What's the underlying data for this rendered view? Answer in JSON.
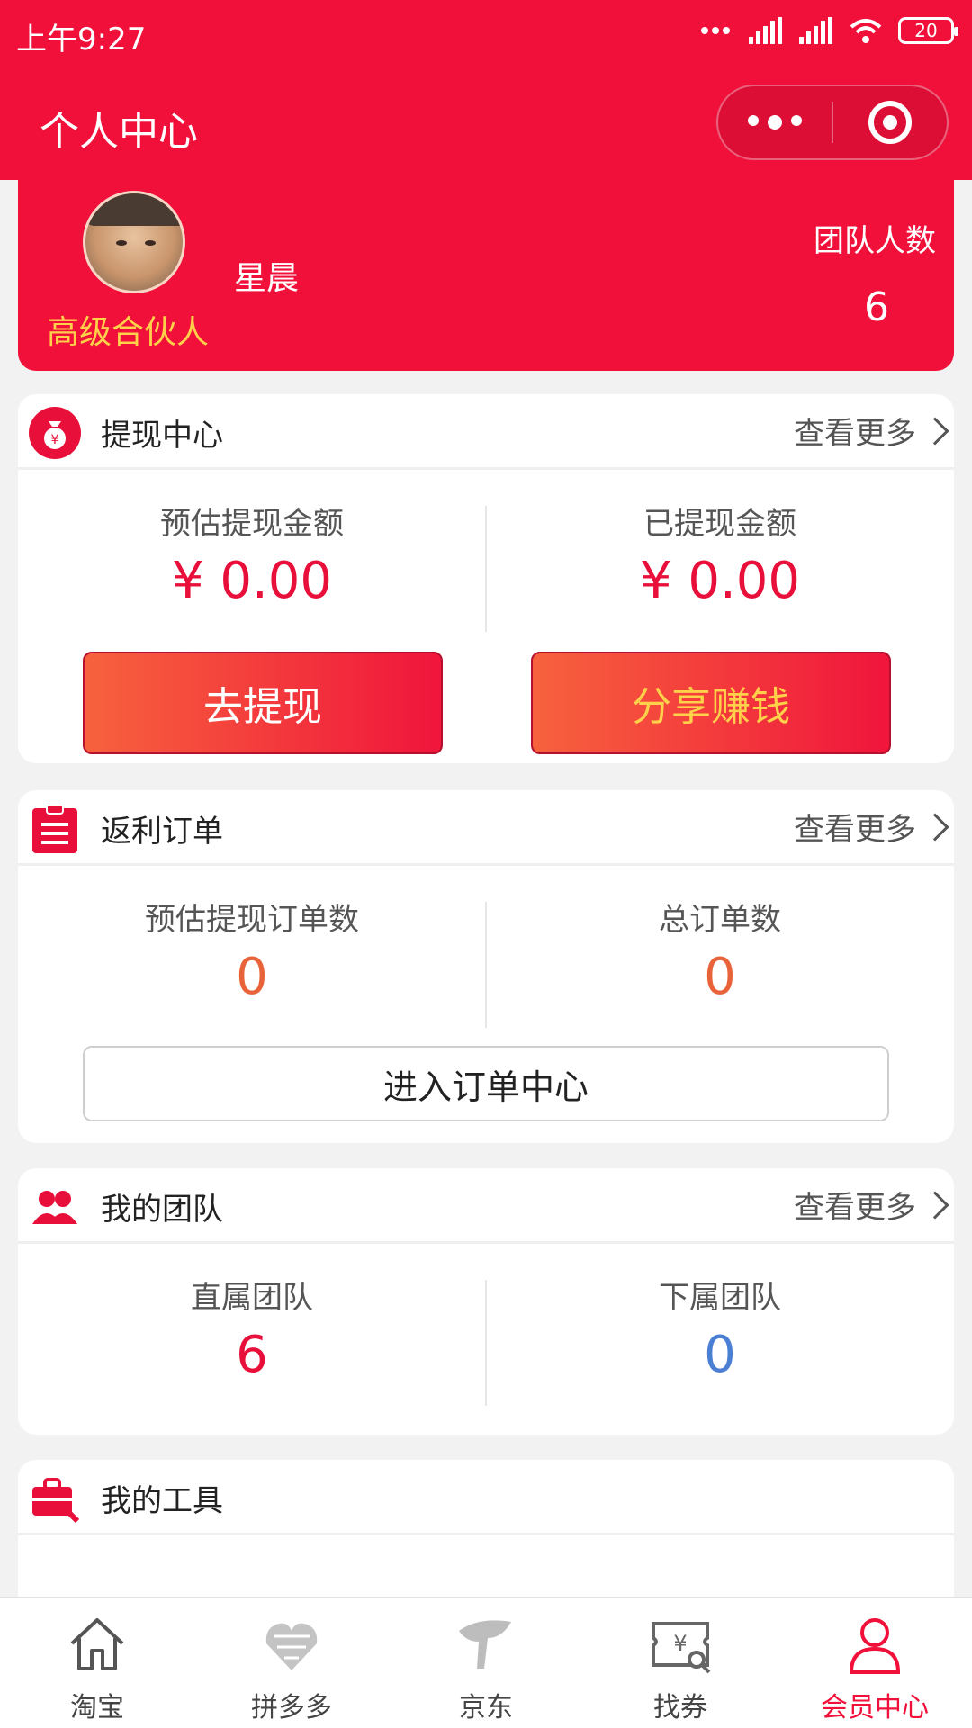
{
  "status_bar": {
    "time": "上午9:27",
    "battery": "20"
  },
  "nav": {
    "title": "个人中心"
  },
  "profile": {
    "username": "星晨",
    "level": "高级合伙人",
    "team_label": "团队人数",
    "team_count": "6"
  },
  "withdraw": {
    "title": "提现中心",
    "more": "查看更多",
    "estimated_label": "预估提现金额",
    "estimated_value": "¥ 0.00",
    "withdrawn_label": "已提现金额",
    "withdrawn_value": "¥ 0.00",
    "withdraw_button": "去提现",
    "share_button": "分享赚钱"
  },
  "orders": {
    "title": "返利订单",
    "more": "查看更多",
    "estimated_label": "预估提现订单数",
    "estimated_value": "0",
    "total_label": "总订单数",
    "total_value": "0",
    "enter_button": "进入订单中心"
  },
  "team": {
    "title": "我的团队",
    "more": "查看更多",
    "direct_label": "直属团队",
    "direct_value": "6",
    "sub_label": "下属团队",
    "sub_value": "0"
  },
  "tools": {
    "title": "我的工具"
  },
  "tabbar": {
    "items": [
      {
        "label": "淘宝",
        "icon": "home-icon"
      },
      {
        "label": "拼多多",
        "icon": "pinduoduo-icon"
      },
      {
        "label": "京东",
        "icon": "jd-icon"
      },
      {
        "label": "找券",
        "icon": "coupon-search-icon"
      },
      {
        "label": "会员中心",
        "icon": "user-icon"
      }
    ],
    "active": "会员中心"
  },
  "colors": {
    "brand": "#f0103a",
    "gold": "#ffd04a",
    "orange_value": "#e8633a",
    "blue_value": "#4a7fd4"
  }
}
